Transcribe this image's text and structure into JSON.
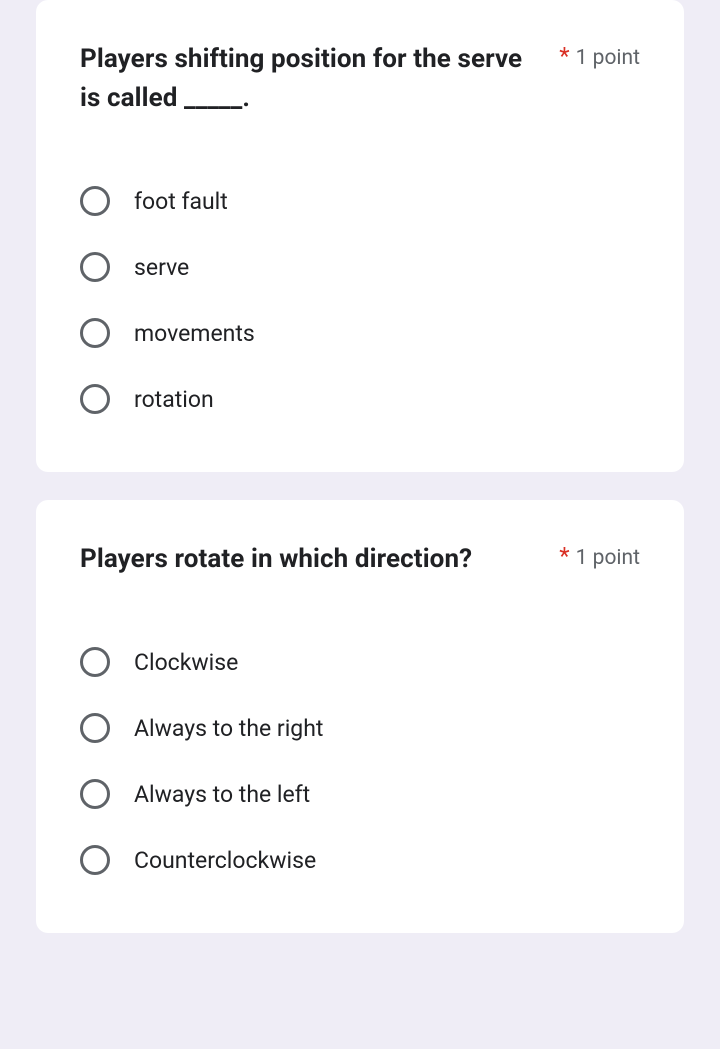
{
  "required_marker": "*",
  "questions": [
    {
      "title": "Players shifting position for the serve is called _____.",
      "points": "1 point",
      "options": [
        "foot fault",
        "serve",
        "movements",
        "rotation"
      ]
    },
    {
      "title": "Players rotate in which direction?",
      "points": "1 point",
      "options": [
        "Clockwise",
        "Always to the right",
        "Always to the left",
        "Counterclockwise"
      ]
    }
  ]
}
